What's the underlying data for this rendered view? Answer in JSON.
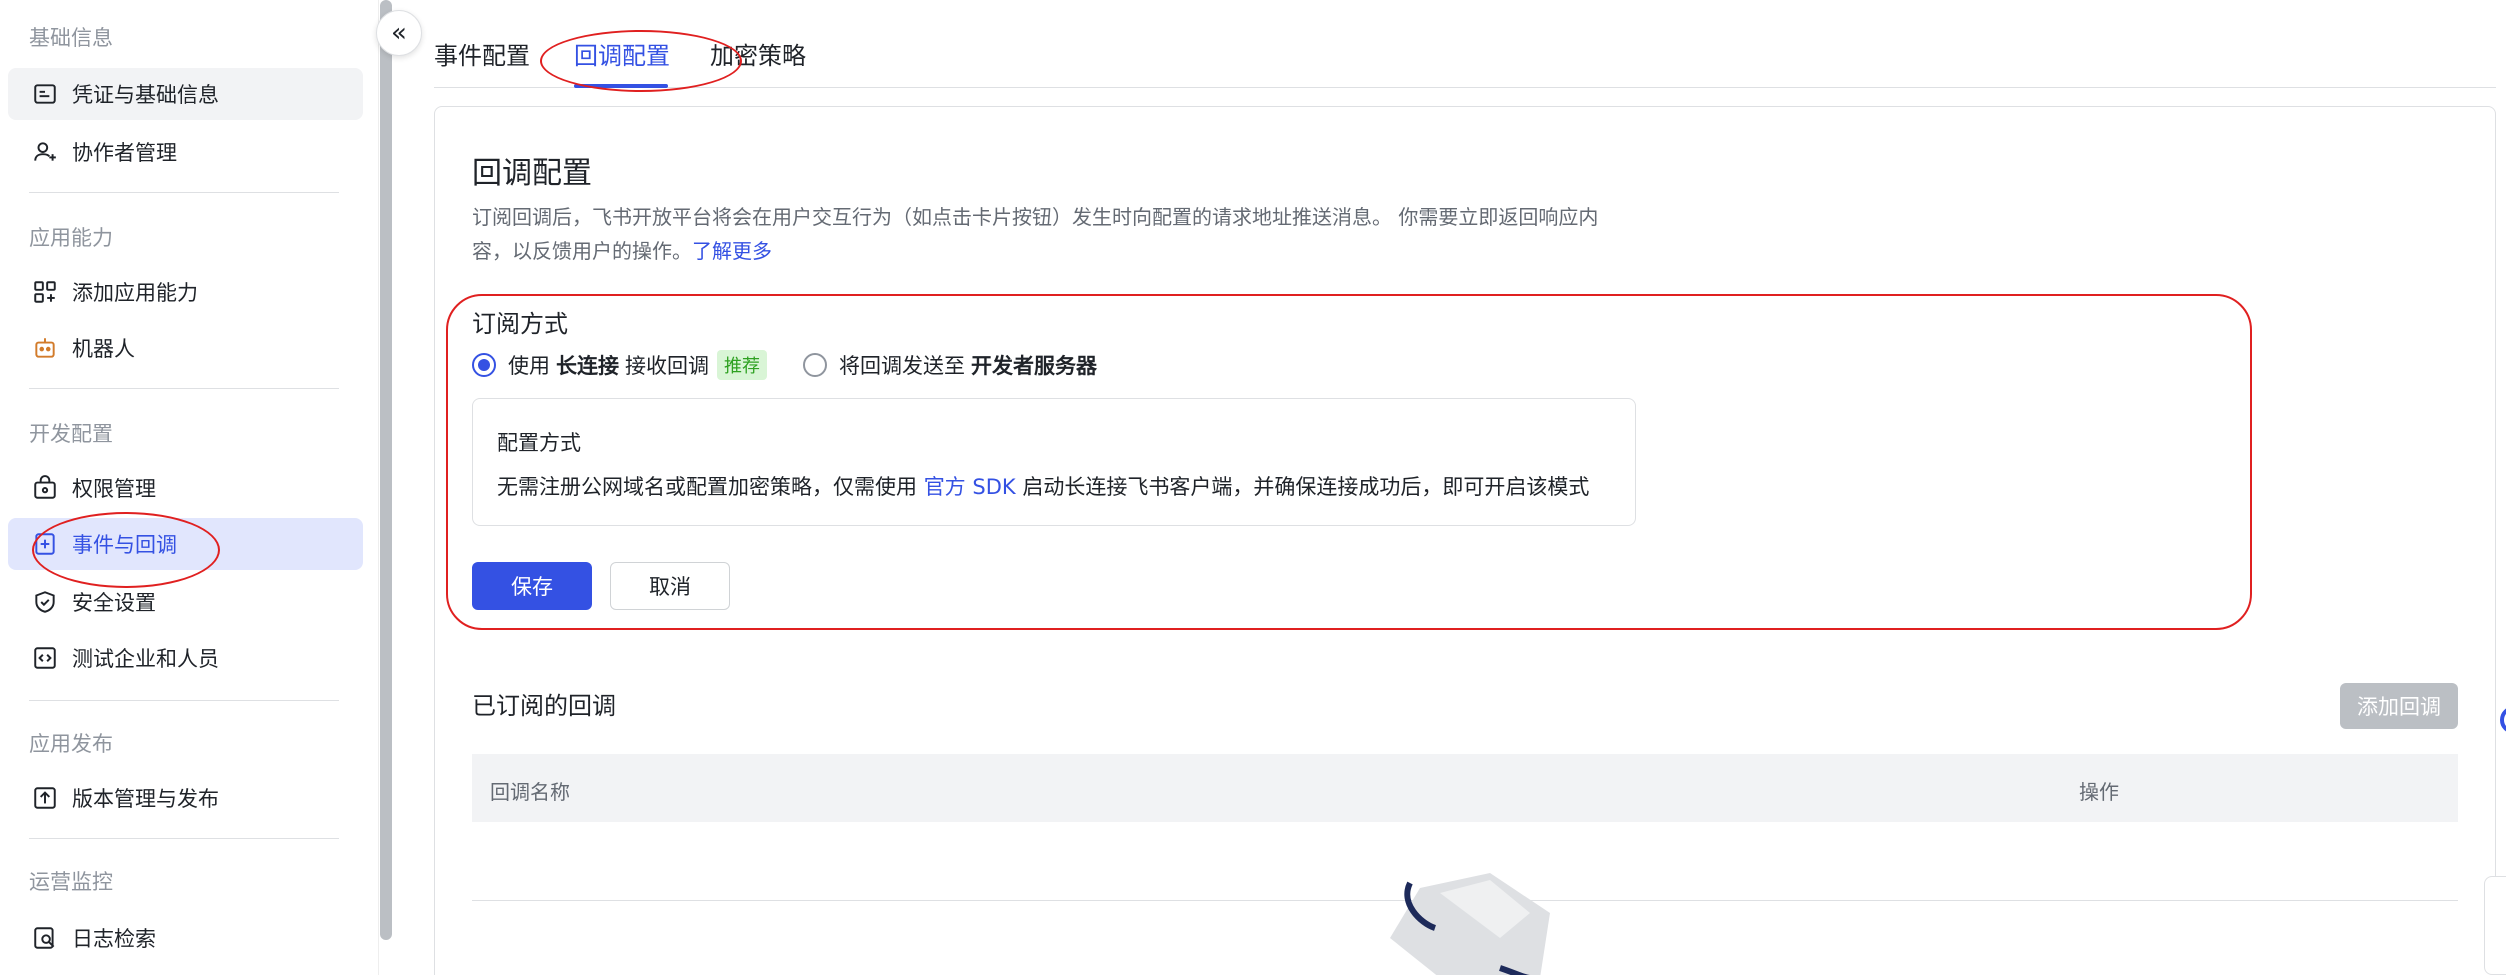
{
  "sidebar": {
    "sections": [
      {
        "label": "基础信息"
      },
      {
        "label": "应用能力"
      },
      {
        "label": "开发配置"
      },
      {
        "label": "应用发布"
      },
      {
        "label": "运营监控"
      }
    ],
    "items": [
      {
        "label": "凭证与基础信息",
        "icon": "credential-icon"
      },
      {
        "label": "协作者管理",
        "icon": "user-add-icon"
      },
      {
        "label": "添加应用能力",
        "icon": "apps-add-icon"
      },
      {
        "label": "机器人",
        "icon": "robot-icon"
      },
      {
        "label": "权限管理",
        "icon": "permission-icon"
      },
      {
        "label": "事件与回调",
        "icon": "event-icon"
      },
      {
        "label": "安全设置",
        "icon": "shield-icon"
      },
      {
        "label": "测试企业和人员",
        "icon": "code-icon"
      },
      {
        "label": "版本管理与发布",
        "icon": "upload-icon"
      },
      {
        "label": "日志检索",
        "icon": "log-search-icon"
      }
    ]
  },
  "tabs": [
    {
      "label": "事件配置"
    },
    {
      "label": "回调配置"
    },
    {
      "label": "加密策略"
    }
  ],
  "main": {
    "title": "回调配置",
    "desc_line1": "订阅回调后，飞书开放平台将会在用户交互行为（如点击卡片按钮）发生时向配置的请求地址推送消息。 你需要立即返回响应内",
    "desc_line2": "容，以反馈用户的操作。",
    "desc_link": "了解更多",
    "subscribe_title": "订阅方式",
    "option1_pre": "使用",
    "option1_bold": "长连接",
    "option1_post": "接收回调",
    "option1_tag": "推荐",
    "option2_pre": "将回调发送至",
    "option2_bold": "开发者服务器",
    "config_title": "配置方式",
    "config_pre": "无需注册公网域名或配置加密策略，仅需使用",
    "config_link": "官方 SDK",
    "config_post": "启动长连接飞书客户端，并确保连接成功后，即可开启该模式",
    "save_label": "保存",
    "cancel_label": "取消",
    "subscribed_title": "已订阅的回调",
    "add_label": "添加回调",
    "table_headers": [
      "回调名称",
      "操作"
    ]
  },
  "colors": {
    "accent": "#3451e3",
    "annotation": "#e02020",
    "recommend_bg": "#d9f5d6",
    "recommend_fg": "#2ea121"
  }
}
